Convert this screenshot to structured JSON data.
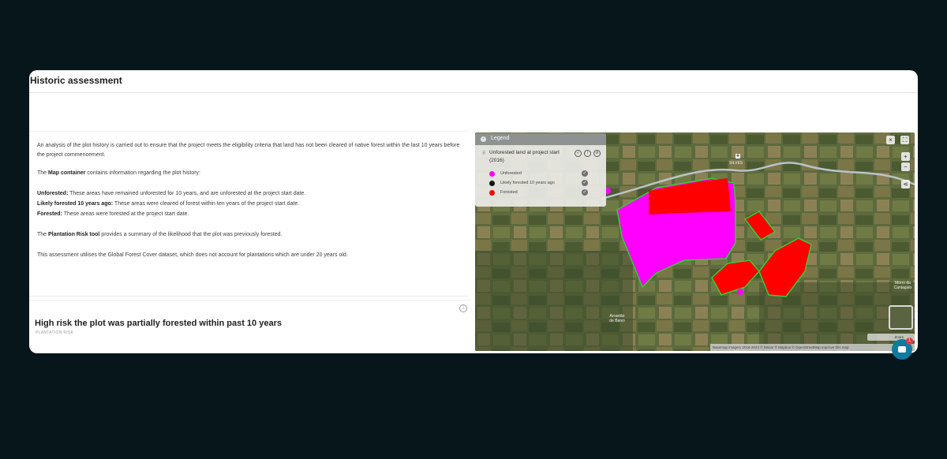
{
  "card": {
    "title": "Historic assessment"
  },
  "description": {
    "intro": "An analysis of the plot history is carried out to ensure that the project meets the eligibility criteria that land has not been cleared of native forest within the last 10 years before the project commencement.",
    "map_prefix": "The ",
    "map_bold": "Map container",
    "map_suffix": " contains information regarding the plot history:",
    "items": [
      {
        "term": "Unforested:",
        "text": " These areas have remained unforested for 10 years, and are unforested at the project start date."
      },
      {
        "term": "Likely forested 10 years ago:",
        "text": " These areas were cleared of forest within ten years of the project start date."
      },
      {
        "term": "Forested:",
        "text": " These areas were forested at the project start date."
      }
    ],
    "tool_prefix": "The ",
    "tool_bold": "Plantation Risk tool",
    "tool_suffix": " provides a summary of the likelihood that the plot was previously forested.",
    "dataset_note": "This assessment utilises the Global Forest Cover dataset, which does not account for plantations which are under 20 years old."
  },
  "risk": {
    "title": "High risk the plot was partially forested within past 10 years",
    "subtitle": "PLANTATION RISK",
    "info_icon": "i"
  },
  "legend": {
    "title": "Legend",
    "layer_name": "Unforested land at project start (2016)",
    "entries": [
      {
        "label": "Unforested",
        "color": "#ff00ff"
      },
      {
        "label": "Likely forested 10 years ago",
        "color": "#111111"
      },
      {
        "label": "Forested",
        "color": "#ff0000"
      }
    ]
  },
  "map": {
    "place_top": "SILVES",
    "place_bottom_1": "Arrastão",
    "place_bottom_2": "de Baixo",
    "place_right_1": "Morro da",
    "place_right_2": "Cantagalo",
    "attribution": "Basemap imagery 2016-2024 © Maxar © Mapbox © OpenStreetMap  Improve this map",
    "zoom_label": "Zoom",
    "road_color": "#b9c3c8",
    "outline_color": "#2fd12f"
  },
  "chat": {
    "badge": "1"
  }
}
